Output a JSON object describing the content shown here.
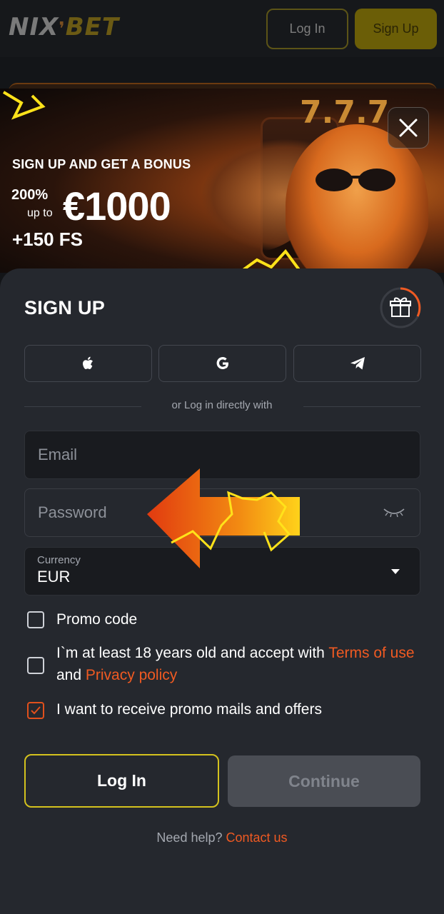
{
  "header": {
    "logo_left": "NIX",
    "logo_right": "BET",
    "login_label": "Log In",
    "signup_label": "Sign Up"
  },
  "banner": {
    "headline": "SIGN UP AND GET A BONUS",
    "percent": "200%",
    "up_to": "up to",
    "amount": "€1000",
    "free_spins": "+150 FS",
    "slot_digits": "7.7.7"
  },
  "signup": {
    "title": "SIGN UP",
    "social_buttons": [
      "apple-icon",
      "google-icon",
      "telegram-icon"
    ],
    "divider_text": "or Log in directly with",
    "email_placeholder": "Email",
    "password_placeholder": "Password",
    "currency_label": "Currency",
    "currency_value": "EUR",
    "promo_label": "Promo code",
    "age_text": "I`m at least 18 years old and accept with",
    "terms_link": "Terms of use",
    "and_text": "and",
    "privacy_link": "Privacy policy",
    "mails_text": "I want to receive promo mails and offers",
    "mails_checked": true,
    "login_label": "Log In",
    "continue_label": "Continue",
    "help_text": "Need help?",
    "contact_link": "Contact us"
  },
  "colors": {
    "accent": "#f05a22",
    "yellow": "#d4c21e",
    "panel": "#25282e"
  }
}
